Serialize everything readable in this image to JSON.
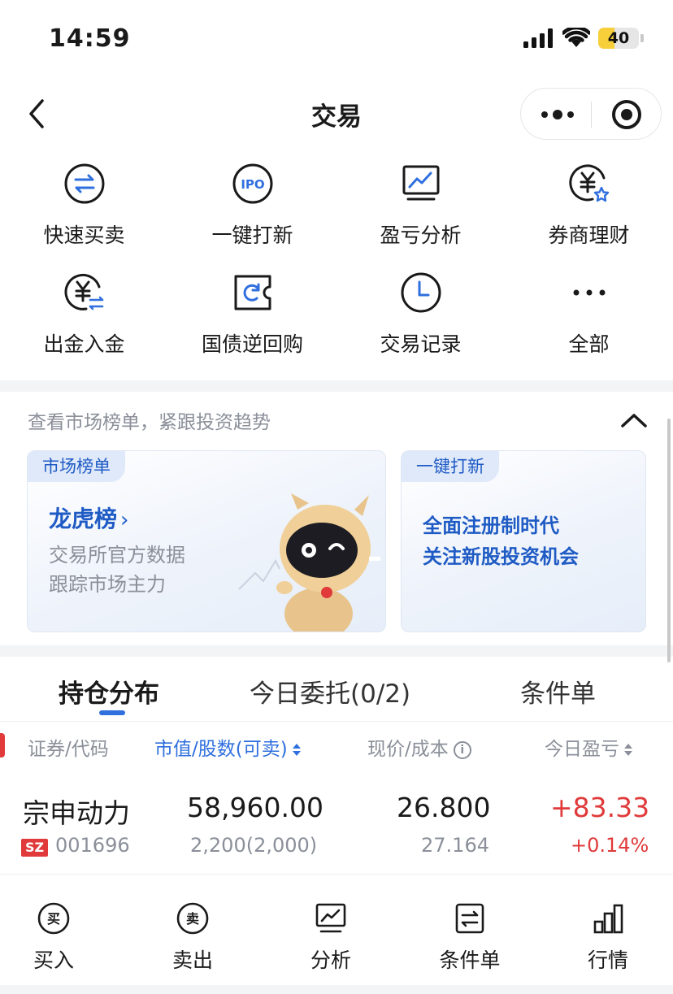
{
  "status_bar": {
    "time": "14:59",
    "battery_level": "40"
  },
  "nav": {
    "title": "交易"
  },
  "functions": [
    {
      "label": "快速买卖",
      "icon": "swap-arrows-icon"
    },
    {
      "label": "一键打新",
      "icon": "ipo-icon"
    },
    {
      "label": "盈亏分析",
      "icon": "chart-monitor-icon"
    },
    {
      "label": "券商理财",
      "icon": "yen-star-icon"
    },
    {
      "label": "出金入金",
      "icon": "yen-transfer-icon"
    },
    {
      "label": "国债逆回购",
      "icon": "repo-ticket-icon"
    },
    {
      "label": "交易记录",
      "icon": "clock-icon"
    },
    {
      "label": "全部",
      "icon": "more-dots-icon"
    }
  ],
  "market": {
    "header": "查看市场榜单，紧跟投资趋势",
    "card_left": {
      "tag": "市场榜单",
      "title": "龙虎榜",
      "arrow": "›",
      "desc1": "交易所官方数据",
      "desc2": "跟踪市场主力"
    },
    "card_right": {
      "tag": "一键打新",
      "line1": "全面注册制时代",
      "line2": "关注新股投资机会"
    }
  },
  "tabs": [
    {
      "label": "持仓分布",
      "active": true
    },
    {
      "label": "今日委托(0/2)",
      "active": false
    },
    {
      "label": "条件单",
      "active": false
    }
  ],
  "table": {
    "columns": [
      "证券/代码",
      "市值/股数(可卖)",
      "现价/成本",
      "今日盈亏"
    ],
    "info_glyph": "i",
    "rows": [
      {
        "name": "宗申动力",
        "exchange": "SZ",
        "code": "001696",
        "market_value": "58,960.00",
        "shares": "2,200(2,000)",
        "price": "26.800",
        "cost": "27.164",
        "pnl": "+83.33",
        "pnl_pct": "+0.14%"
      }
    ]
  },
  "bottom_bar": [
    {
      "label": "买入",
      "glyph": "买"
    },
    {
      "label": "卖出",
      "glyph": "卖"
    },
    {
      "label": "分析"
    },
    {
      "label": "条件单"
    },
    {
      "label": "行情"
    }
  ],
  "colors": {
    "accent": "#2f6fde",
    "up_red": "#e03a3a",
    "muted": "#8a8f99",
    "dark": "#1a1a1a"
  }
}
